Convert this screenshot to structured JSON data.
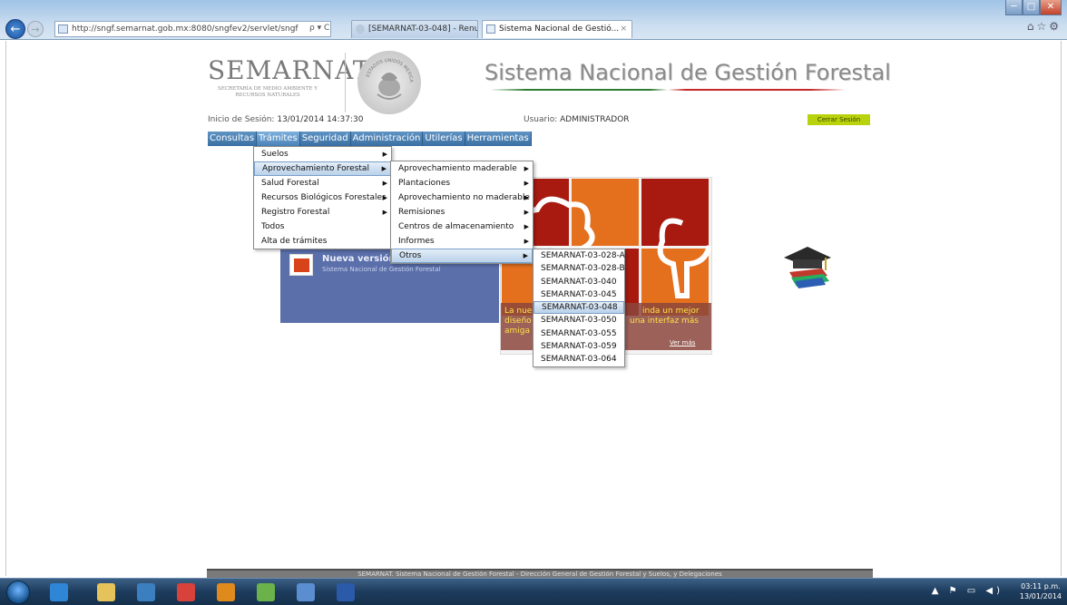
{
  "browser": {
    "url": "http://sngf.semarnat.gob.mx:8080/sngfev2/servlet/sngf",
    "addr_controls": "ρ ▾ C",
    "tabs": [
      {
        "label": "[SEMARNAT-03-048] - Renunc..."
      },
      {
        "label": "Sistema Nacional de Gestió...",
        "close": "×"
      }
    ],
    "window_controls": {
      "minimize": "─",
      "maximize": "□",
      "close": "✕"
    },
    "nav": {
      "back": "←",
      "forward": "→"
    },
    "toolbar_icons": "⌂☆⚙"
  },
  "header": {
    "logo": "SEMARNAT",
    "logo_subtitle": "SECRETARÍA DE MEDIO AMBIENTE Y RECURSOS NATURALES",
    "seal_text": "ESTADOS UNIDOS MEXICANOS",
    "system_title": "Sistema Nacional de Gestión Forestal"
  },
  "session": {
    "login_label": "Inicio de Sesión:",
    "login_value": "13/01/2014 14:37:30",
    "user_label": "Usuario:",
    "user_value": "ADMINISTRADOR",
    "logout": "Cerrar Sesión"
  },
  "menubar": [
    "Consultas",
    "Trámites",
    "Seguridad",
    "Administración",
    "Utilerías",
    "Herramientas"
  ],
  "menu_tramites": [
    {
      "label": "Suelos",
      "submenu": true
    },
    {
      "label": "Aprovechamiento Forestal",
      "submenu": true,
      "selected": true
    },
    {
      "label": "Salud Forestal",
      "submenu": true
    },
    {
      "label": "Recursos Biológicos Forestales",
      "submenu": true
    },
    {
      "label": "Registro Forestal",
      "submenu": true
    },
    {
      "label": "Todos",
      "submenu": false
    },
    {
      "label": "Alta de trámites",
      "submenu": false
    }
  ],
  "menu_aprovechamiento": [
    {
      "label": "Aprovechamiento maderable",
      "submenu": true
    },
    {
      "label": "Plantaciones",
      "submenu": true
    },
    {
      "label": "Aprovechamiento no maderable",
      "submenu": true
    },
    {
      "label": "Remisiones",
      "submenu": true
    },
    {
      "label": "Centros de almacenamiento",
      "submenu": true
    },
    {
      "label": "Informes",
      "submenu": true
    },
    {
      "label": "Otros",
      "submenu": true,
      "selected": true
    }
  ],
  "menu_otros": [
    {
      "label": "SEMARNAT-03-028-A"
    },
    {
      "label": "SEMARNAT-03-028-B"
    },
    {
      "label": "SEMARNAT-03-040"
    },
    {
      "label": "SEMARNAT-03-045"
    },
    {
      "label": "SEMARNAT-03-048",
      "selected": true
    },
    {
      "label": "SEMARNAT-03-050"
    },
    {
      "label": "SEMARNAT-03-055"
    },
    {
      "label": "SEMARNAT-03-059"
    },
    {
      "label": "SEMARNAT-03-064"
    }
  ],
  "news": {
    "title": "Nueva versión del",
    "subtitle": "Sistema Nacional de Gestión Forestal"
  },
  "promo": {
    "line1": "La nue",
    "line1b": "inda un mejor",
    "line2": "diseño",
    "line2b": "una interfaz más",
    "line3": "amiga",
    "more": "Ver más"
  },
  "footer": "SEMARNAT. Sistema Nacional de Gestión Forestal - Dirección General de Gestión Forestal y Suelos, y Delegaciones",
  "taskbar": {
    "tray": "▲ ⚑ ▭ ◀)",
    "time": "03:11 p.m.",
    "date": "13/01/2014",
    "apps": [
      {
        "name": "ie-icon",
        "color": "#2f86d6"
      },
      {
        "name": "file-explorer-icon",
        "color": "#e5c35a"
      },
      {
        "name": "media-player-icon",
        "color": "#3c7fc0"
      },
      {
        "name": "chrome-icon",
        "color": "#d8423a"
      },
      {
        "name": "outlook-icon",
        "color": "#e08a1d"
      },
      {
        "name": "folder-sync-icon",
        "color": "#6bb24a"
      },
      {
        "name": "network-icon",
        "color": "#5a8ed0"
      },
      {
        "name": "word-icon",
        "color": "#2b5aa8"
      }
    ]
  },
  "colors": {
    "menubar": "#3f6f9f",
    "logout": "#b8d20b",
    "news_panel": "#5b6fab",
    "promo_orange": "#e4701e",
    "promo_red": "#a81a10"
  }
}
